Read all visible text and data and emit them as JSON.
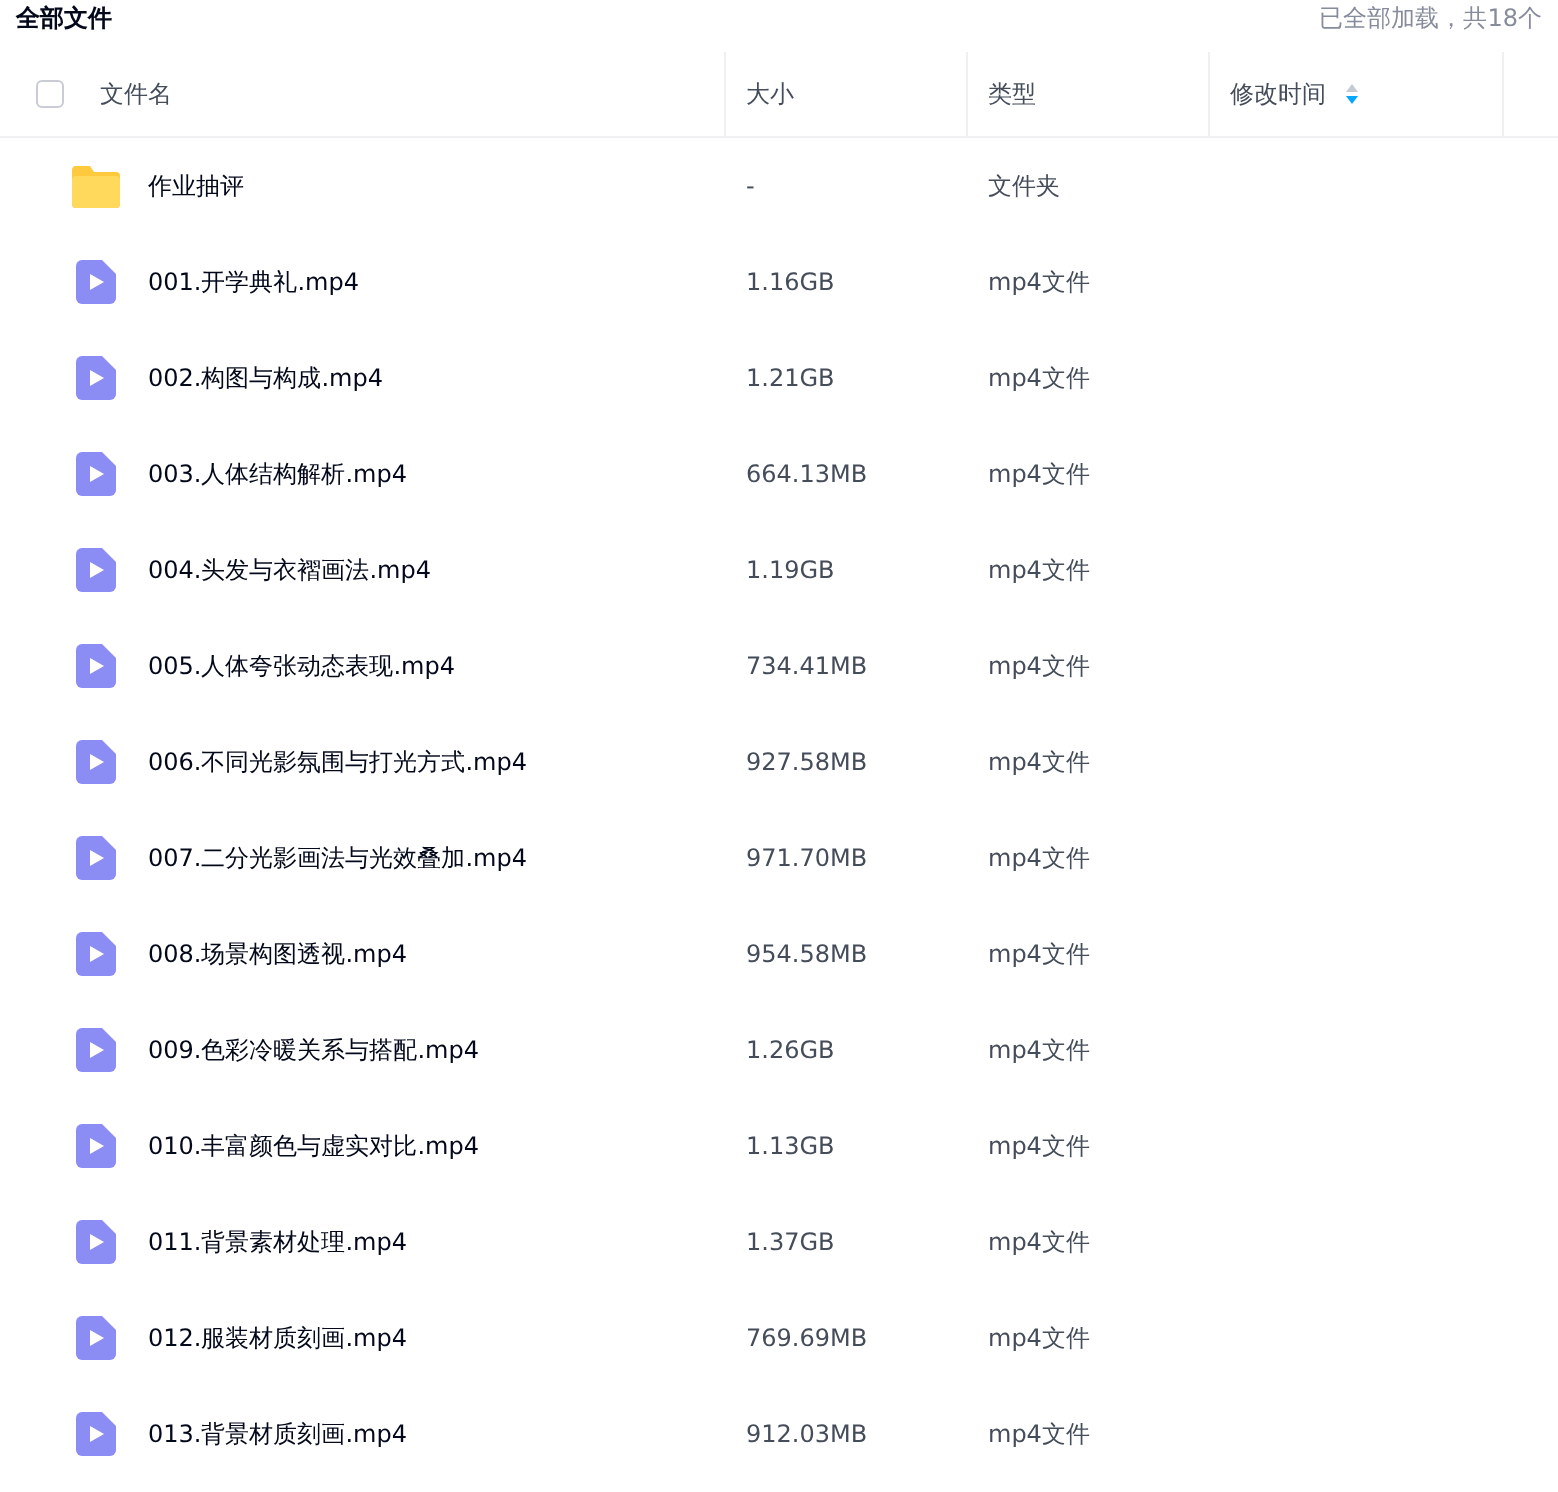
{
  "title": "全部文件",
  "status": "已全部加载，共18个",
  "select_all": {
    "checked": false
  },
  "columns": [
    {
      "label": "文件名",
      "sortable": false
    },
    {
      "label": "大小",
      "sortable": false
    },
    {
      "label": "类型",
      "sortable": false
    },
    {
      "label": "修改时间",
      "sortable": true
    }
  ],
  "rows": [
    {
      "kind": "folder",
      "name": "作业抽评",
      "size": "-",
      "type": "文件夹"
    },
    {
      "kind": "video",
      "name": "001.开学典礼.mp4",
      "size": "1.16GB",
      "type": "mp4文件"
    },
    {
      "kind": "video",
      "name": "002.构图与构成.mp4",
      "size": "1.21GB",
      "type": "mp4文件"
    },
    {
      "kind": "video",
      "name": "003.人体结构解析.mp4",
      "size": "664.13MB",
      "type": "mp4文件"
    },
    {
      "kind": "video",
      "name": "004.头发与衣褶画法.mp4",
      "size": "1.19GB",
      "type": "mp4文件"
    },
    {
      "kind": "video",
      "name": "005.人体夸张动态表现.mp4",
      "size": "734.41MB",
      "type": "mp4文件"
    },
    {
      "kind": "video",
      "name": "006.不同光影氛围与打光方式.mp4",
      "size": "927.58MB",
      "type": "mp4文件"
    },
    {
      "kind": "video",
      "name": "007.二分光影画法与光效叠加.mp4",
      "size": "971.70MB",
      "type": "mp4文件"
    },
    {
      "kind": "video",
      "name": "008.场景构图透视.mp4",
      "size": "954.58MB",
      "type": "mp4文件"
    },
    {
      "kind": "video",
      "name": "009.色彩冷暖关系与搭配.mp4",
      "size": "1.26GB",
      "type": "mp4文件"
    },
    {
      "kind": "video",
      "name": "010.丰富颜色与虚实对比.mp4",
      "size": "1.13GB",
      "type": "mp4文件"
    },
    {
      "kind": "video",
      "name": "011.背景素材处理.mp4",
      "size": "1.37GB",
      "type": "mp4文件"
    },
    {
      "kind": "video",
      "name": "012.服装材质刻画.mp4",
      "size": "769.69MB",
      "type": "mp4文件"
    },
    {
      "kind": "video",
      "name": "013.背景材质刻画.mp4",
      "size": "912.03MB",
      "type": "mp4文件"
    }
  ]
}
